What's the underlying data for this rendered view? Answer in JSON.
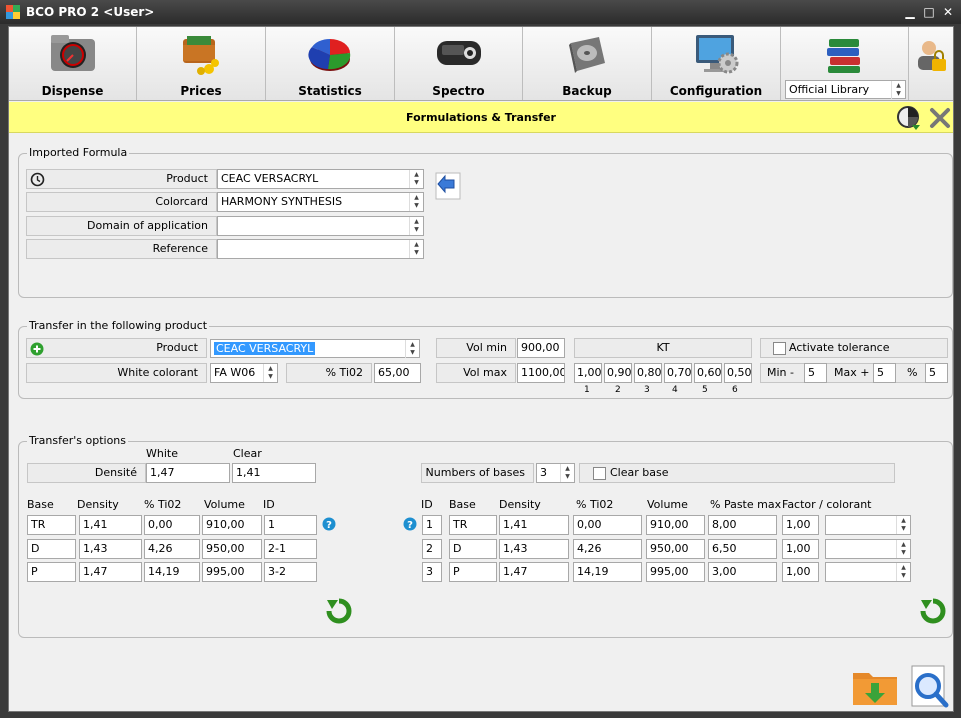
{
  "window": {
    "title": "BCO PRO 2 <User>"
  },
  "toolbar": {
    "items": [
      {
        "label": "Dispense"
      },
      {
        "label": "Prices"
      },
      {
        "label": "Statistics"
      },
      {
        "label": "Spectro"
      },
      {
        "label": "Backup"
      },
      {
        "label": "Configuration"
      }
    ],
    "library": "Official Library"
  },
  "banner": {
    "title": "Formulations & Transfer"
  },
  "imported": {
    "title": "Imported Formula",
    "product_label": "Product",
    "product_value": "CEAC VERSACRYL",
    "colorcard_label": "Colorcard",
    "colorcard_value": "HARMONY SYNTHESIS",
    "domain_label": "Domain of application",
    "domain_value": "",
    "reference_label": "Reference",
    "reference_value": ""
  },
  "transfer": {
    "title": "Transfer in the following product",
    "product_label": "Product",
    "product_value": "CEAC VERSACRYL",
    "white_label": "White colorant",
    "white_value": "FA W06",
    "ti02_label": "% Ti02",
    "ti02_value": "65,00",
    "volmin_label": "Vol min",
    "volmin_value": "900,00",
    "volmax_label": "Vol max",
    "volmax_value": "1100,00",
    "kt_label": "KT",
    "kt_values": [
      "1,00",
      "0,90",
      "0,80",
      "0,70",
      "0,60",
      "0,50"
    ],
    "kt_index": [
      "1",
      "2",
      "3",
      "4",
      "5",
      "6"
    ],
    "tol_label": "Activate tolerance",
    "min_label": "Min -",
    "min_value": "5",
    "max_label": "Max +",
    "max_value": "5",
    "pct_label": "%",
    "pct_value": "5"
  },
  "options": {
    "title": "Transfer's options",
    "white_label": "White",
    "clear_label": "Clear",
    "densite_label": "Densité",
    "white_density": "1,47",
    "clear_density": "1,41",
    "nbases_label": "Numbers of bases",
    "nbases_value": "3",
    "clearbase_label": "Clear base",
    "left_headers": [
      "Base",
      "Density",
      "% Ti02",
      "Volume",
      "ID"
    ],
    "left_rows": [
      [
        "TR",
        "1,41",
        "0,00",
        "910,00",
        "1"
      ],
      [
        "D",
        "1,43",
        "4,26",
        "950,00",
        "2-1"
      ],
      [
        "P",
        "1,47",
        "14,19",
        "995,00",
        "3-2"
      ]
    ],
    "right_headers": [
      "ID",
      "Base",
      "Density",
      "% Ti02",
      "Volume",
      "% Paste max",
      "Factor / colorant"
    ],
    "right_rows": [
      [
        "1",
        "TR",
        "1,41",
        "0,00",
        "910,00",
        "8,00",
        "1,00",
        ""
      ],
      [
        "2",
        "D",
        "1,43",
        "4,26",
        "950,00",
        "6,50",
        "1,00",
        ""
      ],
      [
        "3",
        "P",
        "1,47",
        "14,19",
        "995,00",
        "3,00",
        "1,00",
        ""
      ]
    ]
  }
}
